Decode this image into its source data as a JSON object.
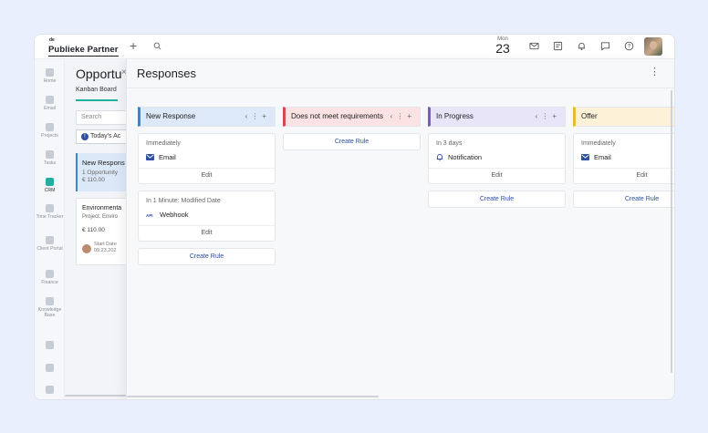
{
  "topbar": {
    "logo_prefix": "de",
    "logo_name": "Publieke Partner",
    "date_dow": "Mon",
    "date_day": "23"
  },
  "nav": [
    {
      "label": "Home",
      "icon": "home-icon"
    },
    {
      "label": "Email",
      "icon": "email-icon"
    },
    {
      "label": "Projects",
      "icon": "projects-icon"
    },
    {
      "label": "Tasks",
      "icon": "tasks-icon"
    },
    {
      "label": "CRM",
      "icon": "crm-icon",
      "active": true
    },
    {
      "label": "Time Tracker",
      "icon": "clock-icon"
    },
    {
      "label": "Client Portal",
      "icon": "portal-icon"
    },
    {
      "label": "Finance",
      "icon": "finance-icon"
    },
    {
      "label": "Knowledge Base",
      "icon": "knowledge-icon"
    }
  ],
  "underlying": {
    "title": "Opportu",
    "tab": "Kanban Board",
    "search_placeholder": "Search",
    "filter": "Today's Ac",
    "stage": {
      "title": "New Respons",
      "count": "1 Opportunity",
      "amount": "€ 110.00"
    },
    "card": {
      "title": "Environmenta",
      "project": "Project: Enviro",
      "amount": "€ 110.00",
      "start_label": "Start Date",
      "start_date": "09.23.202"
    }
  },
  "responses": {
    "title": "Responses",
    "create_rule": "Create Rule",
    "edit": "Edit",
    "columns": [
      {
        "name": "New Response",
        "color": "#3a86d1",
        "bg": "#dde9f8",
        "rules": [
          {
            "when": "Immediately",
            "action": "Email",
            "icon": "email-icon"
          },
          {
            "when": "In 1 Minute: Modified Date",
            "action": "Webhook",
            "icon": "webhook-icon"
          }
        ]
      },
      {
        "name": "Does not meet requirements",
        "color": "#d84a4a",
        "bg": "#fbe3e3",
        "rules": []
      },
      {
        "name": "In Progress",
        "color": "#7b5cc7",
        "bg": "#e9e5f8",
        "rules": [
          {
            "when": "In 3 days",
            "action": "Notification",
            "icon": "bell-icon"
          }
        ]
      },
      {
        "name": "Offer",
        "color": "#e6b93a",
        "bg": "#fdf2d8",
        "rules": [
          {
            "when": "Immediately",
            "action": "Email",
            "icon": "email-icon"
          }
        ]
      }
    ]
  }
}
